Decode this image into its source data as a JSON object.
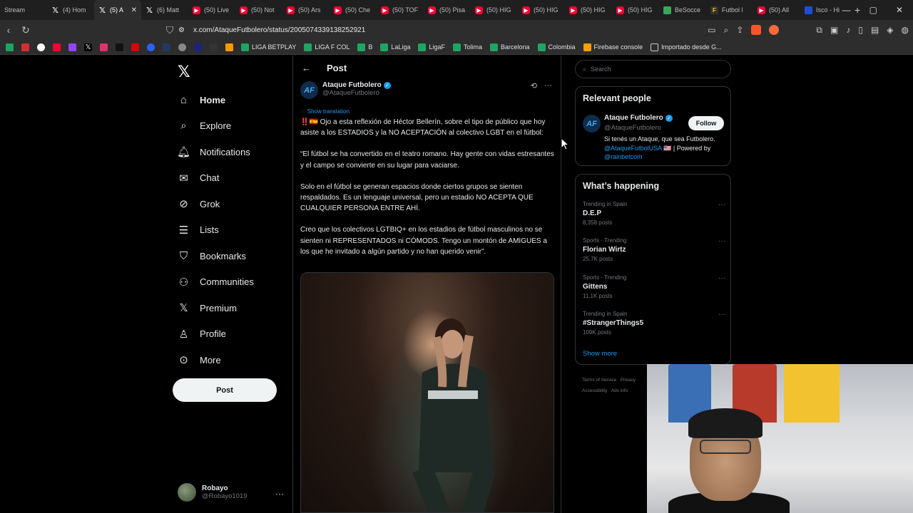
{
  "browser": {
    "tabs": [
      {
        "label": "Stream",
        "icon": "none"
      },
      {
        "label": "(4) Hom",
        "icon": "x"
      },
      {
        "label": "(5) A",
        "icon": "x",
        "active": true
      },
      {
        "label": "(6) Matt",
        "icon": "x"
      },
      {
        "label": "(50) Live",
        "icon": "yt"
      },
      {
        "label": "(50) Not",
        "icon": "yt"
      },
      {
        "label": "(50) Ars",
        "icon": "yt"
      },
      {
        "label": "(50) Che",
        "icon": "yt"
      },
      {
        "label": "(50) TOF",
        "icon": "yt"
      },
      {
        "label": "(50) Pisa",
        "icon": "yt"
      },
      {
        "label": "(50) HIG",
        "icon": "yt"
      },
      {
        "label": "(50) HIG",
        "icon": "yt"
      },
      {
        "label": "(50) HIG",
        "icon": "yt"
      },
      {
        "label": "(50) HIG",
        "icon": "yt"
      },
      {
        "label": "BeSocce",
        "icon": "g"
      },
      {
        "label": "Futbol l",
        "icon": "dk"
      },
      {
        "label": "(50) All",
        "icon": "yt"
      },
      {
        "label": "Isco - Hi",
        "icon": "bl"
      }
    ],
    "url": "x.com/AtaqueFutbolero/status/2005074339138252921",
    "bookmarks": [
      {
        "label": "LIGA BETPLAY",
        "icon": "sheet"
      },
      {
        "label": "LIGA F COL",
        "icon": "sheet"
      },
      {
        "label": "B",
        "icon": "sheet"
      },
      {
        "label": "LaLiga",
        "icon": "sheet"
      },
      {
        "label": "LigaF",
        "icon": "sheet"
      },
      {
        "label": "Tolima",
        "icon": "sheet"
      },
      {
        "label": "Barcelona",
        "icon": "sheet"
      },
      {
        "label": "Colombia",
        "icon": "sheet"
      },
      {
        "label": "Firebase console",
        "icon": "firebase"
      },
      {
        "label": "Importado desde G...",
        "icon": "folder"
      }
    ]
  },
  "nav": {
    "items": [
      {
        "label": "Home",
        "icon": "home-icon"
      },
      {
        "label": "Explore",
        "icon": "search-icon"
      },
      {
        "label": "Notifications",
        "icon": "bell-icon"
      },
      {
        "label": "Chat",
        "icon": "mail-icon"
      },
      {
        "label": "Grok",
        "icon": "grok-icon"
      },
      {
        "label": "Lists",
        "icon": "list-icon"
      },
      {
        "label": "Bookmarks",
        "icon": "bookmark-icon"
      },
      {
        "label": "Communities",
        "icon": "people-icon"
      },
      {
        "label": "Premium",
        "icon": "x-icon"
      },
      {
        "label": "Profile",
        "icon": "person-icon"
      },
      {
        "label": "More",
        "icon": "more-icon"
      }
    ],
    "post_button": "Post",
    "account": {
      "name": "Robayo",
      "handle": "@Robayo1019"
    }
  },
  "post": {
    "header": "Post",
    "author_name": "Ataque Futbolero",
    "author_handle": "@AtaqueFutbolero",
    "show_translation": "Show translation",
    "paragraphs": [
      "‼️🇪🇸 Ojo a esta reflexión de Héctor Bellerín, sobre el tipo de público que hoy asiste a los ESTADIOS y la NO ACEPTACIÓN al colectivo LGBT en el fútbol:",
      "“El fútbol se ha convertido en el teatro romano. Hay gente con vidas estresantes y el campo se convierte en su lugar para vaciarse.",
      "Solo en el fútbol se generan espacios donde ciertos grupos se sienten respaldados. Es un lenguaje universal, pero un estadio NO ACEPTA QUE CUALQUIER PERSONA ENTRE AHÍ.",
      "Creo que los colectivos LGTBIQ+ en los estadios de fútbol masculinos no se sienten ni REPRESENTADOS ni CÓMODS. Tengo un montón de AMIGUES a los que he invitado a algún partido y no han querido venir”."
    ]
  },
  "sidebar": {
    "search_placeholder": "Search",
    "relevant_title": "Relevant people",
    "person": {
      "name": "Ataque Futbolero",
      "handle": "@AtaqueFutbolero",
      "follow": "Follow",
      "bio_text": "Si tenés un Ataque, que sea Futbolero. ",
      "bio_link1": "@AtaqueFutbolUSA",
      "bio_mid": " 🇺🇸 | Powered by ",
      "bio_link2": "@rainbetcom"
    },
    "happening_title": "What’s happening",
    "trends": [
      {
        "context": "Trending in Spain",
        "title": "D.E.P",
        "posts": "8,358 posts"
      },
      {
        "context": "Sports · Trending",
        "title": "Florian Wirtz",
        "posts": "25.7K posts"
      },
      {
        "context": "Sports · Trending",
        "title": "Gittens",
        "posts": "11.1K posts"
      },
      {
        "context": "Trending in Spain",
        "title": "#StrangerThings5",
        "posts": "109K posts"
      }
    ],
    "show_more": "Show more",
    "footer": [
      "Terms of Service",
      "Privacy",
      "Accessibility",
      "Ads info"
    ]
  },
  "colors": {
    "accent": "#1d9bf0",
    "background": "#000000",
    "border": "#2f3336"
  }
}
